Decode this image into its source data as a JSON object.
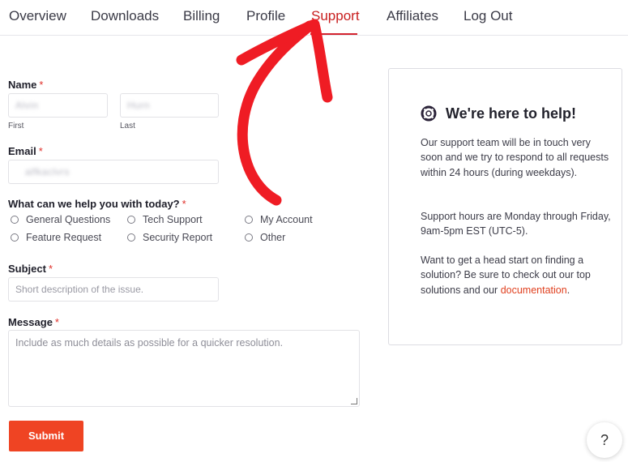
{
  "tabs": [
    "Overview",
    "Downloads",
    "Billing",
    "Profile",
    "Support",
    "Affiliates",
    "Log Out"
  ],
  "active_tab": "Support",
  "form": {
    "name_label": "Name",
    "required_mark": "*",
    "first_value": "Alvin",
    "last_value": "Hurn",
    "first_sublabel": "First",
    "last_sublabel": "Last",
    "email_label": "Email",
    "email_value": "alfkaclvrs",
    "topic_label": "What can we help you with today?",
    "topic_options": [
      "General Questions",
      "Tech Support",
      "My Account",
      "Feature Request",
      "Security Report",
      "Other"
    ],
    "subject_label": "Subject",
    "subject_placeholder": "Short description of the issue.",
    "message_label": "Message",
    "message_placeholder": "Include as much details as possible for a quicker resolution.",
    "submit_label": "Submit"
  },
  "help_card": {
    "title": "We're here to help!",
    "para1": "Our support team will be in touch very soon and we try to respond to all requests within 24 hours (during weekdays).",
    "para2": "Support hours are Monday through Friday, 9am-5pm EST (UTC-5).",
    "para3_text": "Want to get a head start on finding a solution? Be sure to check out our top solutions and our",
    "para3_link": "documentation",
    "para3_end": "."
  },
  "help_button": "?",
  "colors": {
    "accent": "#ef4423",
    "active_tab": "#c81e1e",
    "annotation_arrow": "#ef1c24"
  },
  "icons": {
    "card_icon": "lifebuoy-icon",
    "annotation": "hand-drawn-arrow"
  }
}
